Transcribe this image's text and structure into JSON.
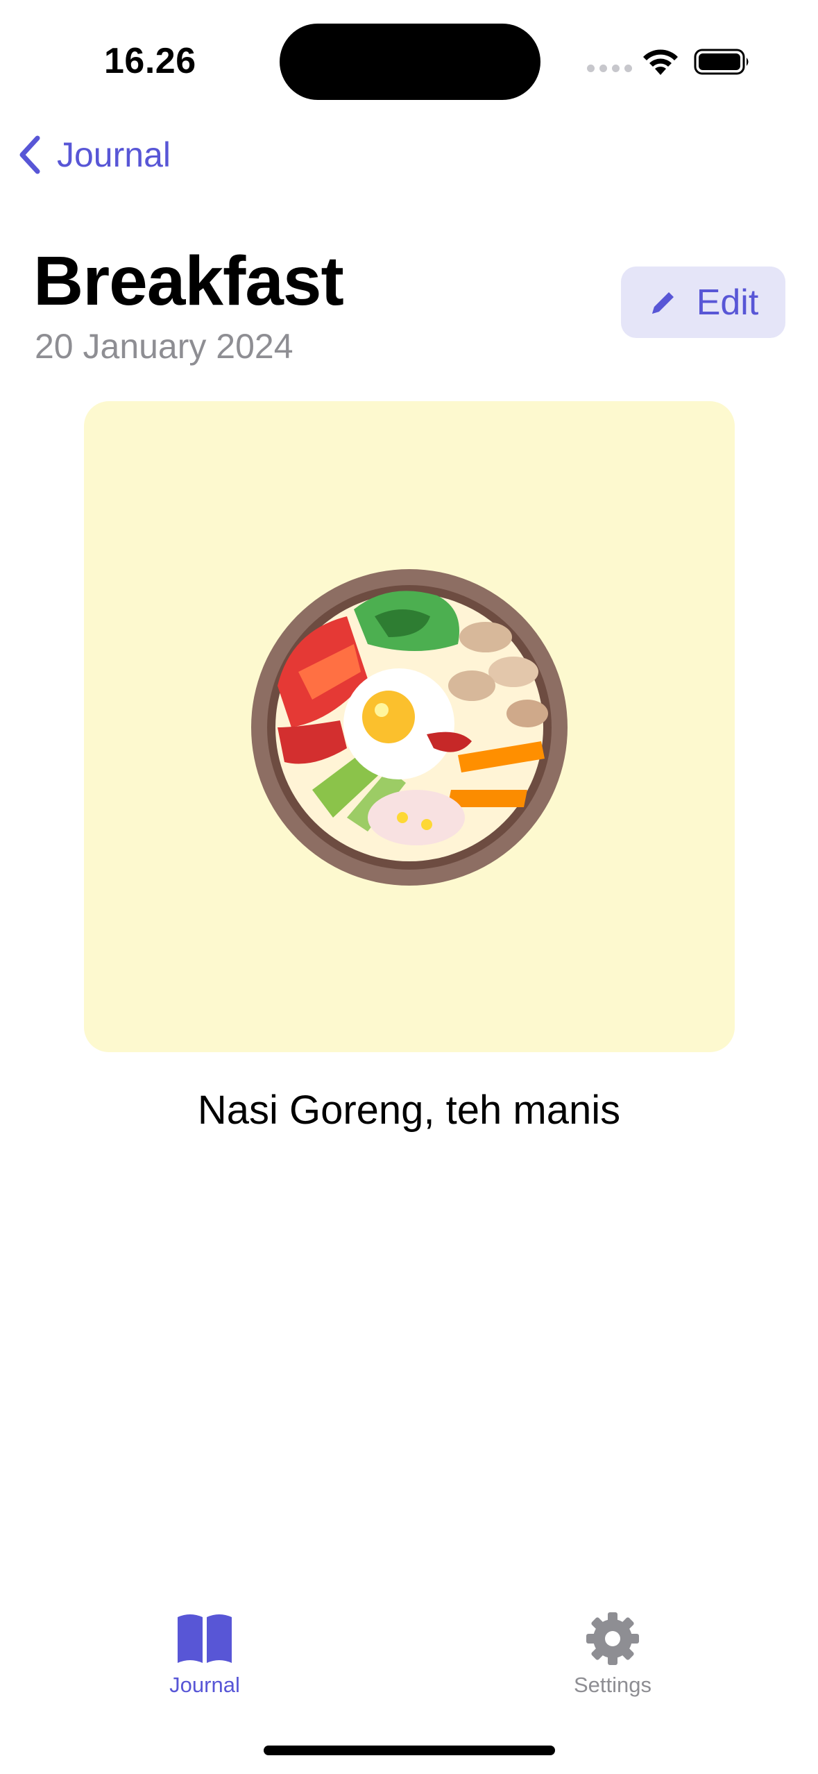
{
  "status_bar": {
    "time": "16.26",
    "icons": [
      "cellular-signal-icon",
      "wifi-icon",
      "battery-icon"
    ]
  },
  "nav": {
    "back_label": "Journal"
  },
  "header": {
    "title": "Breakfast",
    "date": "20 January 2024",
    "edit_label": "Edit"
  },
  "entry": {
    "image": "food-bowl-illustration",
    "caption": "Nasi Goreng, teh manis"
  },
  "tab_bar": {
    "tabs": [
      {
        "label": "Journal",
        "icon": "book-icon",
        "selected": true
      },
      {
        "label": "Settings",
        "icon": "gear-icon",
        "selected": false
      }
    ]
  },
  "colors": {
    "accent": "#5856d6",
    "secondary_text": "#8e8e93",
    "edit_button_bg": "#e5e5f8",
    "photo_bg": "#fdf9cf"
  }
}
